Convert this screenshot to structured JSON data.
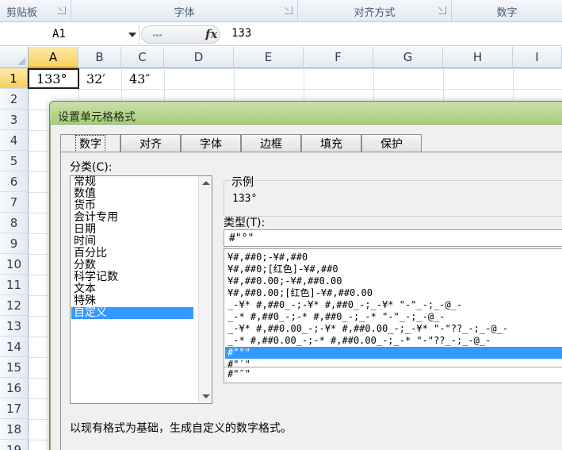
{
  "ribbon": {
    "groups": [
      "剪贴板",
      "字体",
      "对齐方式",
      "数字"
    ]
  },
  "formula_bar": {
    "name_box": "A1",
    "fx_label": "fx",
    "formula": "133"
  },
  "sheet": {
    "columns": [
      "A",
      "B",
      "C",
      "D",
      "E",
      "F",
      "G",
      "H",
      "I"
    ],
    "rows": [
      "1",
      "2",
      "3",
      "4",
      "5",
      "6",
      "7",
      "8",
      "9",
      "10",
      "11",
      "12",
      "13",
      "14",
      "15",
      "16",
      "17",
      "18",
      "19"
    ],
    "cells": {
      "A1": "133°",
      "B1": "32′",
      "C1": "43″"
    },
    "active_cell": "A1"
  },
  "dialog": {
    "title": "设置单元格格式",
    "tabs": [
      "数字",
      "对齐",
      "字体",
      "边框",
      "填充",
      "保护"
    ],
    "active_tab": "数字",
    "category_label": "分类(C):",
    "categories": [
      "常规",
      "数值",
      "货币",
      "会计专用",
      "日期",
      "时间",
      "百分比",
      "分数",
      "科学记数",
      "文本",
      "特殊",
      "自定义"
    ],
    "selected_category": "自定义",
    "sample_label": "示例",
    "sample_value": "133°",
    "type_label": "类型(T):",
    "type_value": "#\"°\"",
    "formats": [
      "¥#,##0;-¥#,##0",
      "¥#,##0;[红色]-¥#,##0",
      "¥#,##0.00;-¥#,##0.00",
      "¥#,##0.00;[红色]-¥#,##0.00",
      "_-¥* #,##0_-;-¥* #,##0_-;_-¥* \"-\"_-;_-@_-",
      "_-* #,##0_-;-* #,##0_-;_-* \"-\"_-;_-@_-",
      "_-¥* #,##0.00_-;-¥* #,##0.00_-;_-¥* \"-\"??_-;_-@_-",
      "_-* #,##0.00_-;-* #,##0.00_-;_-* \"-\"??_-;_-@_-",
      "#\"°\"",
      "#\"′\"",
      "#\"″\""
    ],
    "selected_format_index": 8,
    "description": "以现有格式为基础，生成自定义的数字格式。"
  },
  "colors": {
    "selection": "#3399ff",
    "dialog_title_bar": "#a9cd79",
    "active_header": "#f7cf5f"
  }
}
